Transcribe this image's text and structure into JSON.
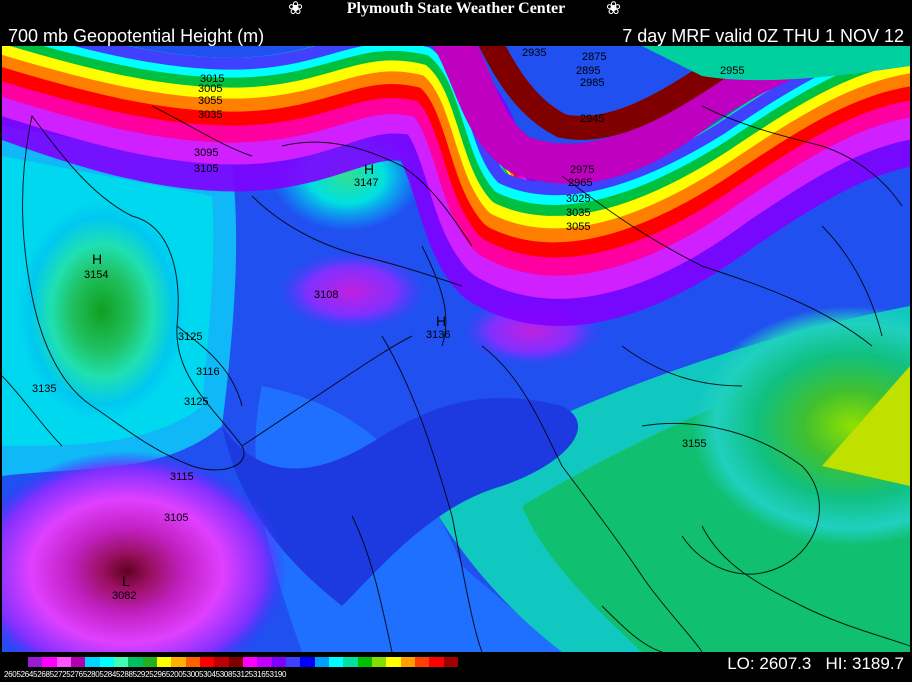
{
  "header": {
    "center_title": "Plymouth State Weather Center",
    "map_title": "700 mb Geopotential Height (m)",
    "valid_time": "7 day MRF valid 0Z THU 1 NOV 12"
  },
  "footer": {
    "lo_label": "LO:",
    "lo_value": "2607.3",
    "hi_label": "HI:",
    "hi_value": "3189.7",
    "colorbar_labels": "26052645268527252765280528452885292529652005300530453085312531653190"
  },
  "map": {
    "contour_labels": [
      "3154",
      "3147",
      "3108",
      "3136",
      "3125",
      "3116",
      "3135",
      "3125",
      "3115",
      "3105",
      "3082",
      "3155",
      "3055",
      "3035",
      "3015",
      "3005",
      "3095",
      "3105",
      "2975",
      "2945",
      "2965",
      "2985",
      "2875",
      "2895",
      "2935",
      "2955",
      "3025",
      "3035",
      "3055"
    ],
    "centers": [
      "H",
      "H",
      "H",
      "L"
    ]
  },
  "colorbar_colors": [
    "#9a1cd0",
    "#ff00ff",
    "#ff55ff",
    "#b000b0",
    "#00d4ff",
    "#00ffff",
    "#40ffb0",
    "#00c060",
    "#20b020",
    "#ffff00",
    "#ffb000",
    "#ff6000",
    "#ff0000",
    "#c00000",
    "#800000",
    "#ff00ff",
    "#c000ff",
    "#8000ff",
    "#4040ff",
    "#0000ff",
    "#00a0ff",
    "#00ffff",
    "#00e0a0",
    "#00c000",
    "#80e000",
    "#ffff00",
    "#ffa000",
    "#ff4000",
    "#ff0000",
    "#a00000"
  ]
}
